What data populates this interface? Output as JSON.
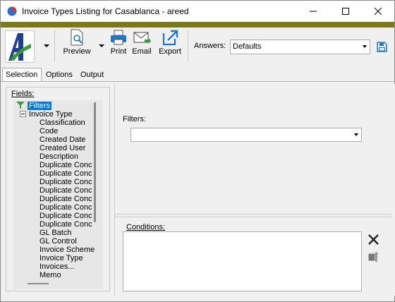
{
  "window": {
    "title": "Invoice Types Listing for Casablanca - areed"
  },
  "toolbar": {
    "preview_label": "Preview",
    "print_label": "Print",
    "email_label": "Email",
    "export_label": "Export",
    "answers_label": "Answers:",
    "answers_value": "Defaults"
  },
  "tabs": [
    {
      "label": "Selection"
    },
    {
      "label": "Options"
    },
    {
      "label": "Output"
    }
  ],
  "fields": {
    "label": "Fields:",
    "root": "Filters",
    "group": "Invoice Type",
    "items": [
      "Classification",
      "Code",
      "Created Date",
      "Created User",
      "Description",
      "Duplicate Conc",
      "Duplicate Conc",
      "Duplicate Conc",
      "Duplicate Conc",
      "Duplicate Conc",
      "Duplicate Conc",
      "Duplicate Conc",
      "Duplicate Conc",
      "GL Batch",
      "GL Control",
      "Invoice Scheme",
      "Invoice Type",
      "Invoices...",
      "Memo"
    ]
  },
  "filters": {
    "label": "Filters:",
    "value": ""
  },
  "conditions": {
    "label": "Conditions:"
  },
  "colors": {
    "accent": "#7b7a17",
    "selection": "#0078d7",
    "logo_blue": "#1f3f8f",
    "logo_green": "#3a9a3a",
    "icon_blue": "#1e78c8"
  }
}
